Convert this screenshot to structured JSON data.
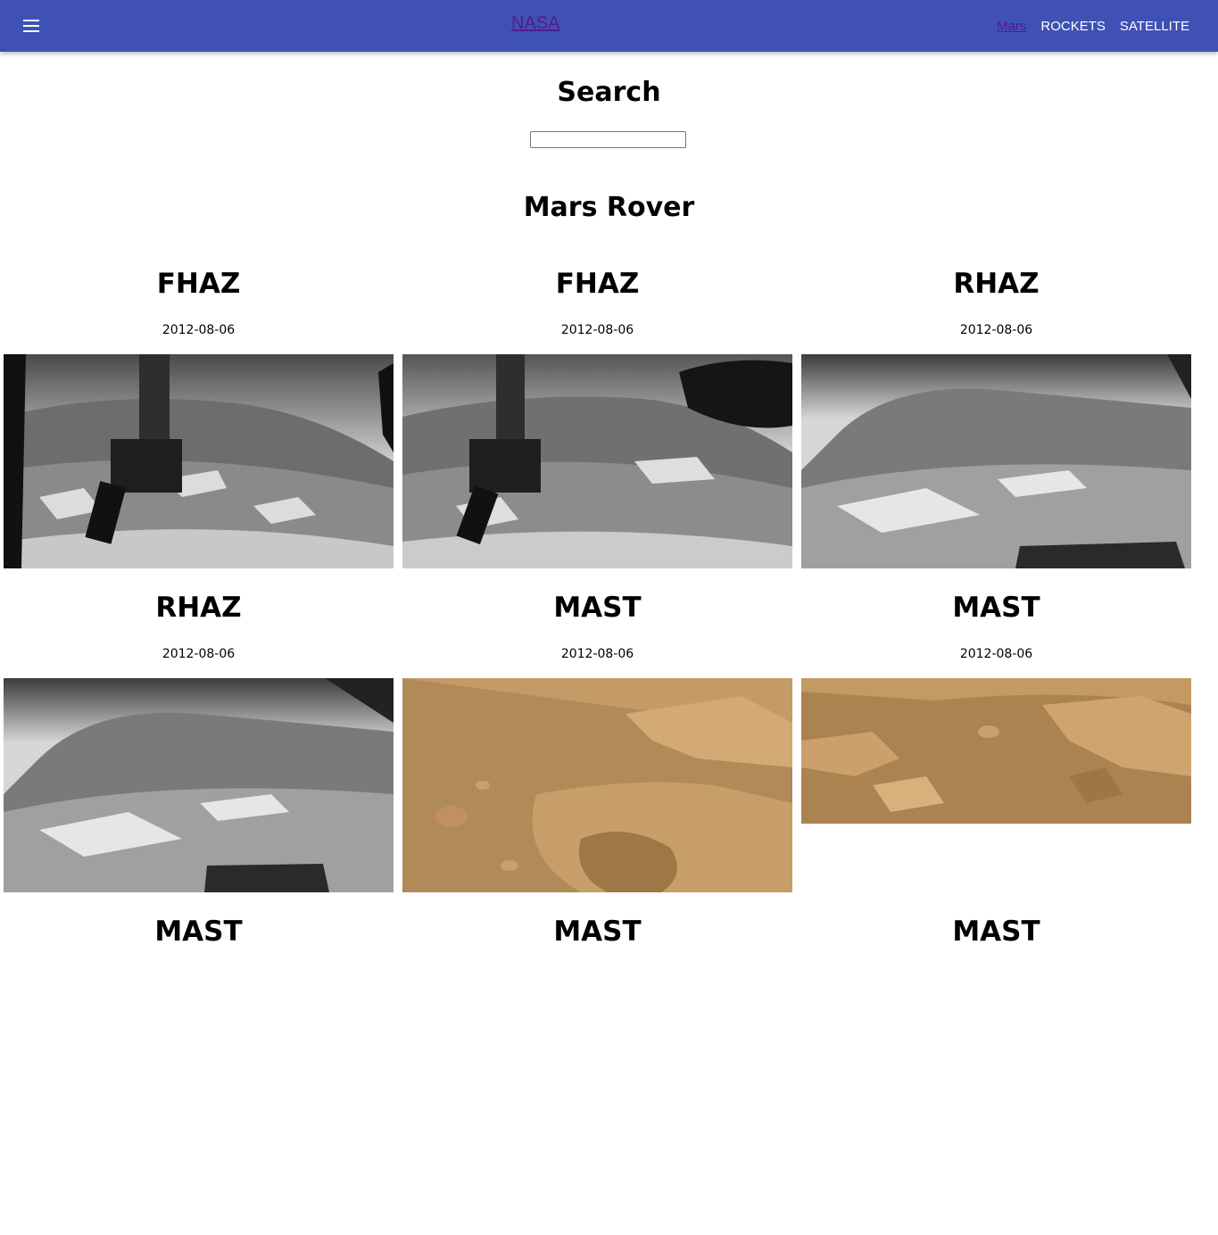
{
  "navbar": {
    "brand": "NASA",
    "links": [
      "Mars",
      "ROCKETS",
      "SATELLITE"
    ],
    "colors": {
      "bar": "#3f51b5",
      "visited_link": "#551a8b"
    },
    "menu_icon": "hamburger-icon"
  },
  "search": {
    "title": "Search",
    "value": "",
    "placeholder": ""
  },
  "section": {
    "title": "Mars Rover"
  },
  "photos": [
    {
      "camera": "FHAZ",
      "earth_date": "2012-08-06",
      "kind": "grayscale-arm"
    },
    {
      "camera": "FHAZ",
      "earth_date": "2012-08-06",
      "kind": "grayscale-arm"
    },
    {
      "camera": "RHAZ",
      "earth_date": "2012-08-06",
      "kind": "grayscale-terrain"
    },
    {
      "camera": "RHAZ",
      "earth_date": "2012-08-06",
      "kind": "grayscale-terrain"
    },
    {
      "camera": "MAST",
      "earth_date": "2012-08-06",
      "kind": "color-rocks"
    },
    {
      "camera": "MAST",
      "earth_date": "2012-08-06",
      "kind": "color-rocks-wide"
    },
    {
      "camera": "MAST"
    },
    {
      "camera": "MAST"
    },
    {
      "camera": "MAST"
    }
  ]
}
